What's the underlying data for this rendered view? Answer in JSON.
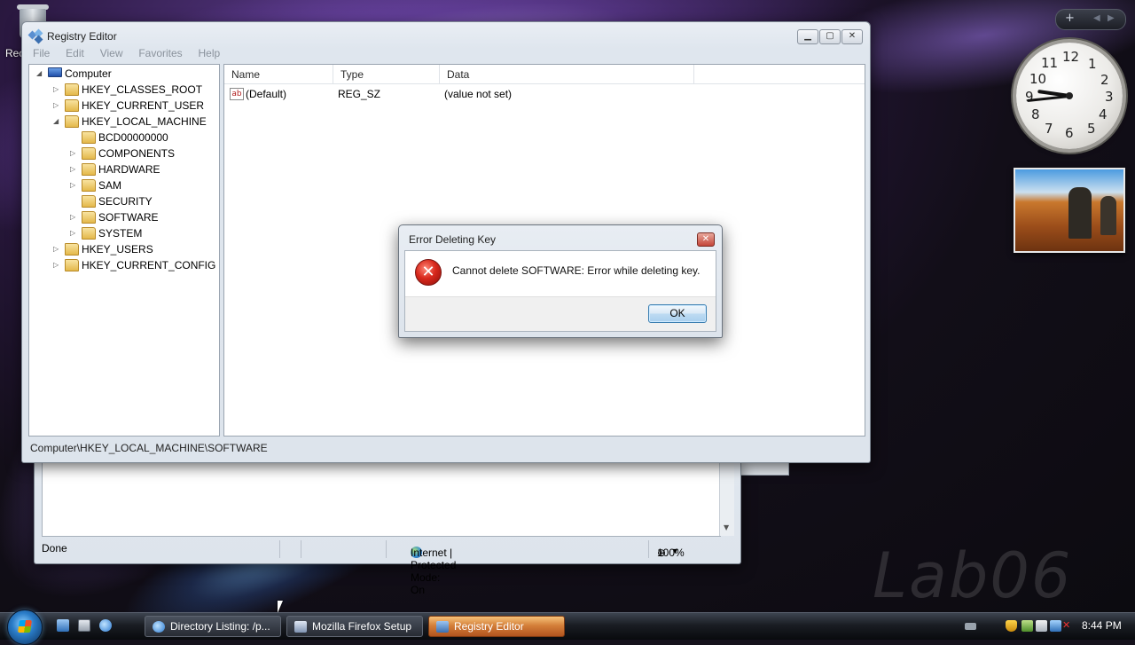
{
  "desktop": {
    "recycle_bin_label": "Rec",
    "watermark": "Lab06"
  },
  "gadgets": {
    "sidebar_add": "+",
    "clock_numbers": [
      "12",
      "1",
      "2",
      "3",
      "4",
      "5",
      "6",
      "7",
      "8",
      "9",
      "10",
      "11"
    ],
    "clock_time": "8:44"
  },
  "browser": {
    "status_text": "Done",
    "zone_text": "Internet | Protected Mode: On",
    "zoom": "100%"
  },
  "regedit": {
    "title": "Registry Editor",
    "menu": [
      "File",
      "Edit",
      "View",
      "Favorites",
      "Help"
    ],
    "tree": [
      {
        "label": "Computer",
        "level": 0,
        "expander": "◢",
        "icon": "computer-icon"
      },
      {
        "label": "HKEY_CLASSES_ROOT",
        "level": 1,
        "expander": "▷",
        "icon": "folder-icon"
      },
      {
        "label": "HKEY_CURRENT_USER",
        "level": 1,
        "expander": "▷",
        "icon": "folder-icon"
      },
      {
        "label": "HKEY_LOCAL_MACHINE",
        "level": 1,
        "expander": "◢",
        "icon": "folder-icon"
      },
      {
        "label": "BCD00000000",
        "level": 2,
        "expander": "",
        "icon": "folder-icon"
      },
      {
        "label": "COMPONENTS",
        "level": 2,
        "expander": "▷",
        "icon": "folder-icon"
      },
      {
        "label": "HARDWARE",
        "level": 2,
        "expander": "▷",
        "icon": "folder-icon"
      },
      {
        "label": "SAM",
        "level": 2,
        "expander": "▷",
        "icon": "folder-icon"
      },
      {
        "label": "SECURITY",
        "level": 2,
        "expander": "",
        "icon": "folder-icon"
      },
      {
        "label": "SOFTWARE",
        "level": 2,
        "expander": "▷",
        "icon": "folder-icon"
      },
      {
        "label": "SYSTEM",
        "level": 2,
        "expander": "▷",
        "icon": "folder-icon"
      },
      {
        "label": "HKEY_USERS",
        "level": 1,
        "expander": "▷",
        "icon": "folder-icon"
      },
      {
        "label": "HKEY_CURRENT_CONFIG",
        "level": 1,
        "expander": "▷",
        "icon": "folder-icon"
      }
    ],
    "columns": [
      "Name",
      "Type",
      "Data"
    ],
    "values": [
      {
        "name": "(Default)",
        "type": "REG_SZ",
        "data": "(value not set)",
        "icon": "string-value-icon",
        "icon_text": "ab"
      }
    ],
    "status_path": "Computer\\HKEY_LOCAL_MACHINE\\SOFTWARE"
  },
  "dialog": {
    "title": "Error Deleting Key",
    "message": "Cannot delete SOFTWARE:  Error while deleting key.",
    "ok_label": "OK",
    "icon": "error-icon"
  },
  "taskbar": {
    "tasks": [
      {
        "label": "Directory Listing: /p...",
        "icon": "ie-icon",
        "active": false
      },
      {
        "label": "Mozilla Firefox Setup",
        "icon": "installer-icon",
        "active": false
      },
      {
        "label": "Registry Editor",
        "icon": "regedit-icon",
        "active": true
      }
    ],
    "time": "8:44 PM"
  }
}
